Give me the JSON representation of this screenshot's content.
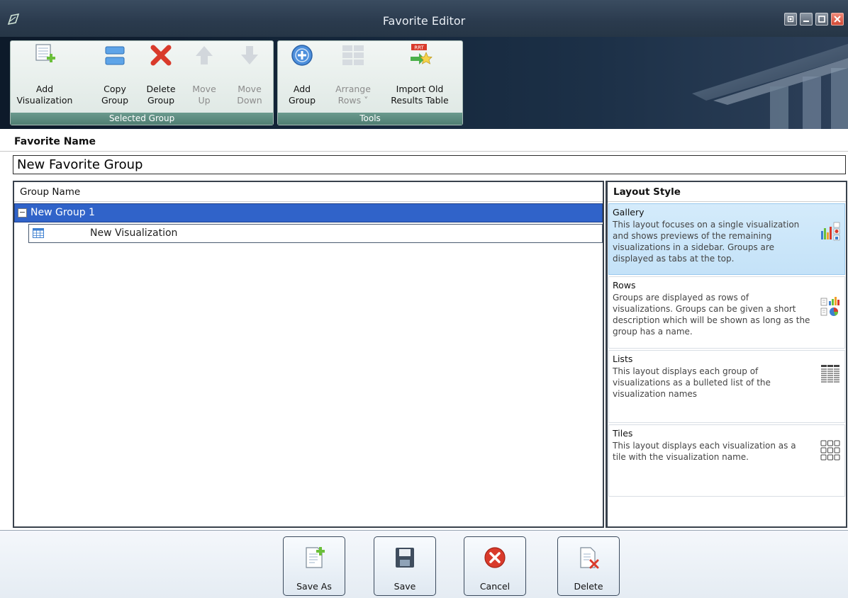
{
  "window": {
    "title": "Favorite Editor"
  },
  "ribbon": {
    "groups": [
      {
        "label": "Selected Group"
      },
      {
        "label": "Tools"
      }
    ],
    "buttons": {
      "add_visualization": "Add\nVisualization",
      "copy_group": "Copy\nGroup",
      "delete_group": "Delete\nGroup",
      "move_up": "Move\nUp",
      "move_down": "Move\nDown",
      "add_group": "Add\nGroup",
      "arrange_rows": "Arrange\nRows ˅",
      "import_old": "Import Old\nResults Table"
    }
  },
  "favorite": {
    "label": "Favorite Name",
    "value": "New Favorite Group"
  },
  "tree": {
    "header": "Group Name",
    "groups": [
      {
        "name": "New Group 1",
        "toggle": "−",
        "items": [
          {
            "name": "New Visualization"
          }
        ]
      }
    ]
  },
  "layout": {
    "header": "Layout Style",
    "options": [
      {
        "name": "Gallery",
        "desc": "This layout focuses on a single visualization and shows previews of the remaining visualizations in a sidebar. Groups are displayed as tabs at the top.",
        "selected": true
      },
      {
        "name": "Rows",
        "desc": "Groups are displayed as rows of visualizations.  Groups can be given a short description which will be shown as long as the group has a name.",
        "selected": false
      },
      {
        "name": "Lists",
        "desc": "This layout displays each group of visualizations as a bulleted list of the visualization names",
        "selected": false
      },
      {
        "name": "Tiles",
        "desc": "This layout displays each visualization as a tile with the visualization name.",
        "selected": false
      }
    ]
  },
  "bottom": {
    "save_as": "Save As",
    "save": "Save",
    "cancel": "Cancel",
    "delete": "Delete"
  },
  "colors": {
    "selection": "#3063c9",
    "ribbon_group": "#4f7e72",
    "delete_red": "#d93a2b"
  }
}
